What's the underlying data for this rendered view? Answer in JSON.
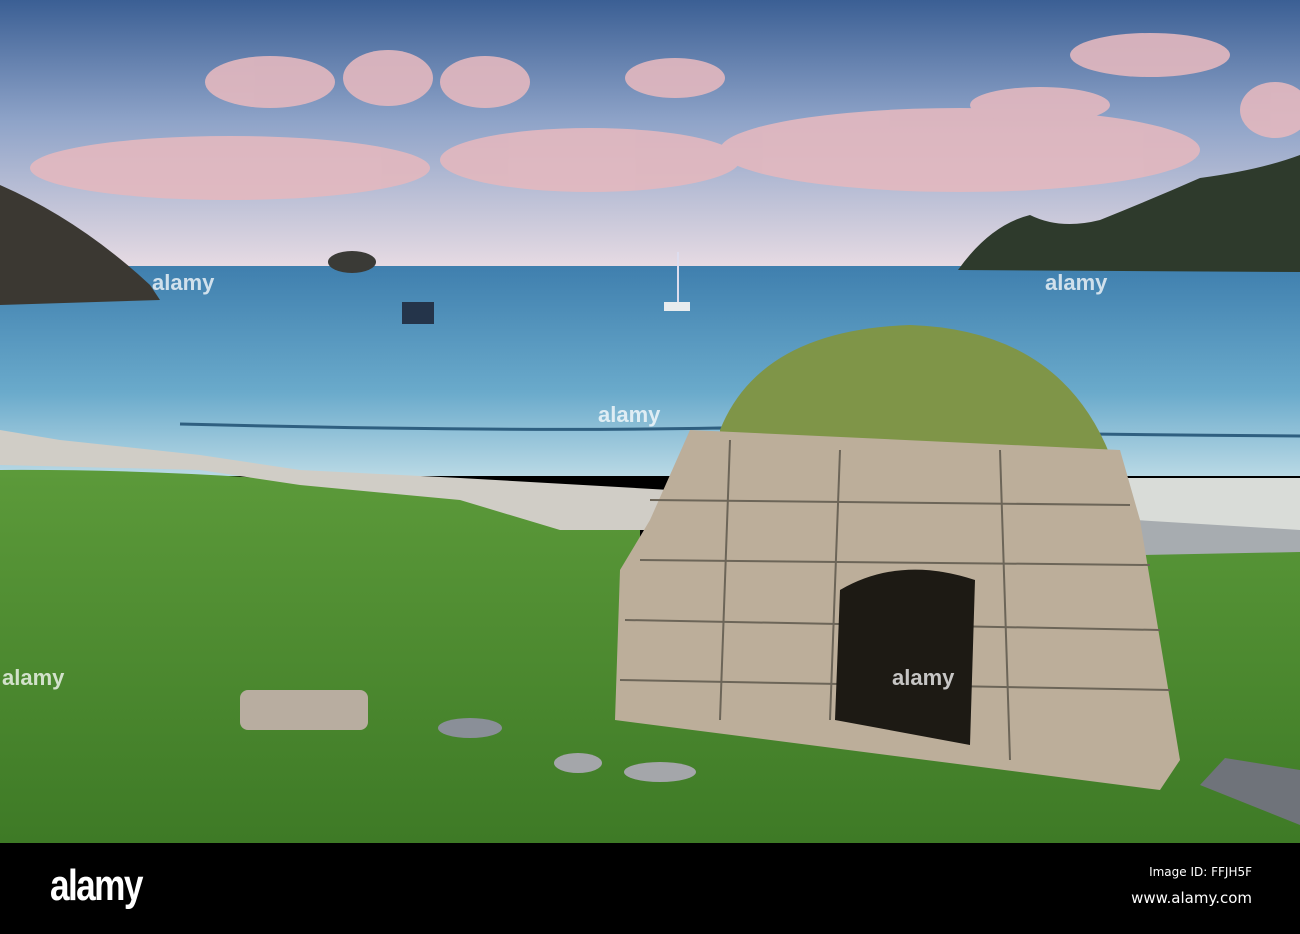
{
  "photo": {
    "subject": "stone beehive hut on grassy shore with bay and boats"
  },
  "watermark": {
    "text": "alamy"
  },
  "footer": {
    "logo": "alamy",
    "image_id": "Image ID: FFJH5F",
    "website": "www.alamy.com"
  },
  "colors": {
    "sky_top": "#3b5f94",
    "sky_horizon": "#e7dbe3",
    "sea": "#5b9cc2",
    "grass": "#4d8a2e",
    "footer": "#000000"
  }
}
